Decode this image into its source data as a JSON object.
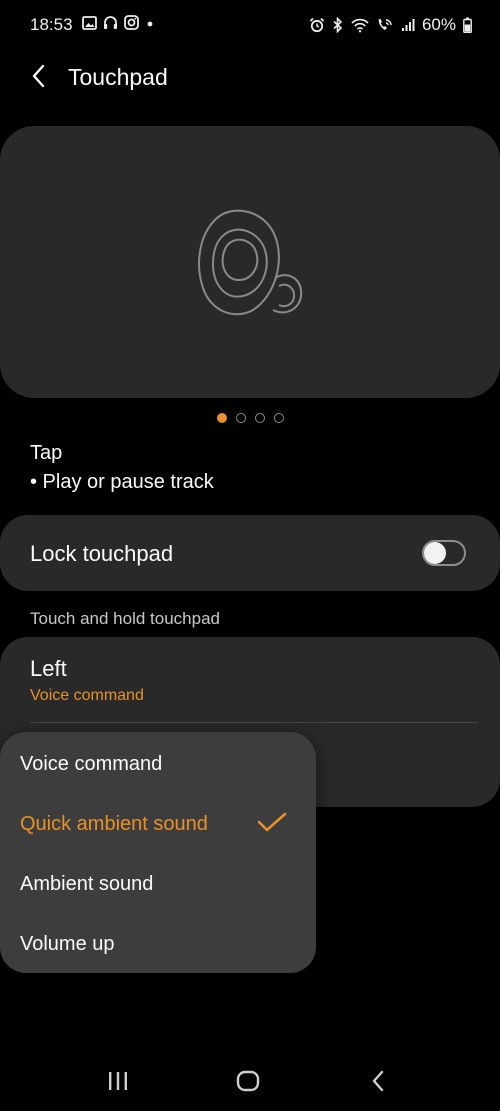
{
  "status_bar": {
    "time": "18:53",
    "battery": "60%",
    "left_icons": [
      "gallery-icon",
      "headset-icon",
      "instagram-icon",
      "dot-icon"
    ],
    "right_icons": [
      "alarm-icon",
      "bluetooth-icon",
      "wifi-icon",
      "wifi-calling-icon",
      "signal-icon",
      "battery-icon"
    ]
  },
  "app_bar": {
    "title": "Touchpad"
  },
  "carousel": {
    "page_count": 4,
    "active_index": 0
  },
  "tap": {
    "title": "Tap",
    "description": "• Play or pause track"
  },
  "lock_touchpad": {
    "label": "Lock touchpad",
    "enabled": false
  },
  "touch_hold": {
    "section_header": "Touch and hold touchpad",
    "left": {
      "title": "Left",
      "value": "Voice command"
    }
  },
  "dropdown": {
    "options": [
      {
        "label": "Voice command",
        "selected": false
      },
      {
        "label": "Quick ambient sound",
        "selected": true
      },
      {
        "label": "Ambient sound",
        "selected": false
      },
      {
        "label": "Volume up",
        "selected": false
      }
    ]
  },
  "colors": {
    "accent": "#e8912a",
    "card": "#292929",
    "menu": "#3d3d3d",
    "background": "#000000"
  },
  "nav_bar": {
    "icons": [
      "recents-icon",
      "home-icon",
      "back-icon"
    ]
  }
}
